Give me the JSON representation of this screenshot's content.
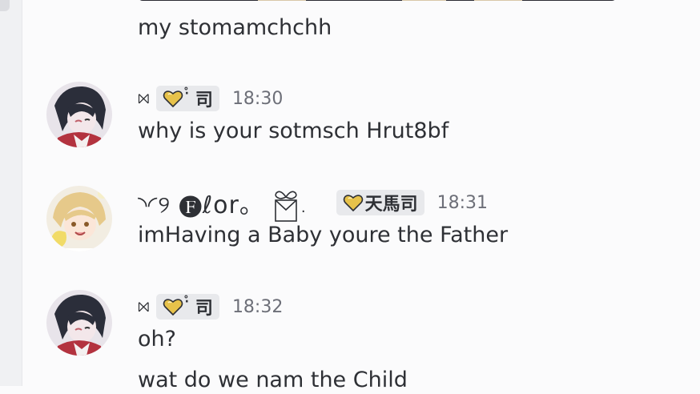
{
  "messages": [
    {
      "text": "my stomamchchh"
    },
    {
      "author_glyph": "⨝",
      "tag": "司",
      "tag_prefix": "·̊",
      "time": "18:30",
      "text": "why is your sotmsch Hrut8bf"
    },
    {
      "author_name": "◝◜୨ 🅕ℓor。",
      "dot": ".",
      "tag": "天馬司",
      "time": "18:31",
      "text": "imHaving a Baby youre the Father"
    },
    {
      "author_glyph": "⨝",
      "tag": "司",
      "tag_prefix": "·̊",
      "time": "18:32",
      "text": "oh?"
    },
    {
      "text": "wat do we nam the  Child"
    }
  ],
  "colors": {
    "background": "#fbfbfc",
    "text": "#2e3035",
    "timestamp": "#6d6f78",
    "tag_bg": "#e8e9ec",
    "heart": "#e7c24a"
  },
  "icons": [
    "heart-icon",
    "gift-icon",
    "avatar"
  ]
}
